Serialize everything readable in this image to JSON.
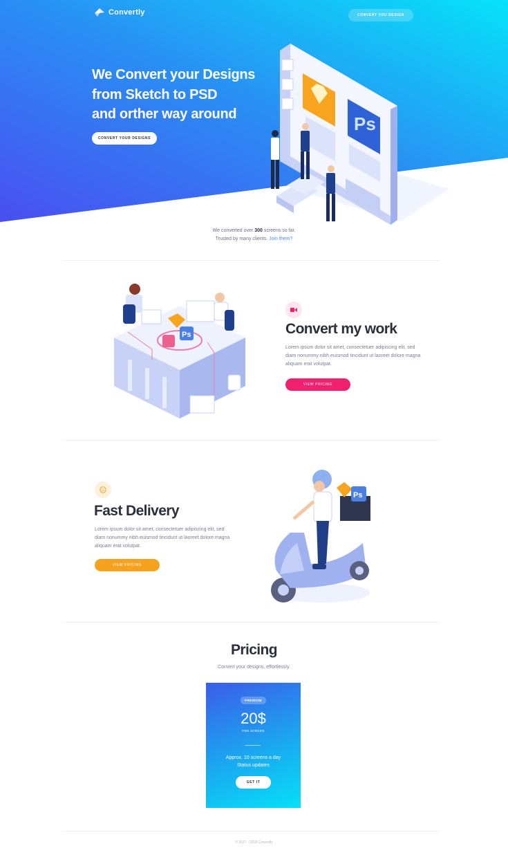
{
  "brand": {
    "name": "Convertly"
  },
  "nav": {
    "cta_label": "CONVERT YOU DESIGN"
  },
  "hero": {
    "title_lines": [
      "We Convert your Designs",
      "from Sketch to PSD",
      "and orther way around"
    ],
    "cta_label": "CONVERT YOUR DESIGNS"
  },
  "trust": {
    "prefix": "We converted over ",
    "count": "300",
    "suffix": " screens so far.",
    "line2": "Trusted by many clients. ",
    "link": "Join them?"
  },
  "features": [
    {
      "title": "Convert my work",
      "text": "Lorem ipsum dolor sit amet, consectetuer adipiscing elit, sed diam nonummy nibh euismod tincidunt ut laoreet dolore magna aliquam erat volutpat.",
      "button": "VIEW PRICING",
      "icon": "sketch-convert-icon",
      "accent": "#f0206e"
    },
    {
      "title": "Fast Delivery",
      "text": "Lorem ipsum dolor sit amet, consectetuer adipiscing elit, sed diam nonummy nibh euismod tincidunt ut laoreet dolore magna aliquam erat volutpat.",
      "button": "VIEW PRICING",
      "icon": "smiley-icon",
      "accent": "#f7a21f"
    }
  ],
  "pricing": {
    "title": "Pricing",
    "subtitle": "Convert your designs, effortlessly.",
    "plan": {
      "badge": "PREMIUM",
      "price": "20$",
      "per": "PER SCREEN",
      "features": [
        "Approx. 10 screens a day",
        "Status updates"
      ],
      "button": "GET IT"
    }
  },
  "footer": {
    "text": "© 2017 - 2018 Convertly"
  },
  "colors": {
    "hero_start": "#4a4ef0",
    "hero_end": "#06e3f8",
    "pink": "#f0206e",
    "orange": "#f7a21f",
    "link": "#4a8cf5"
  }
}
